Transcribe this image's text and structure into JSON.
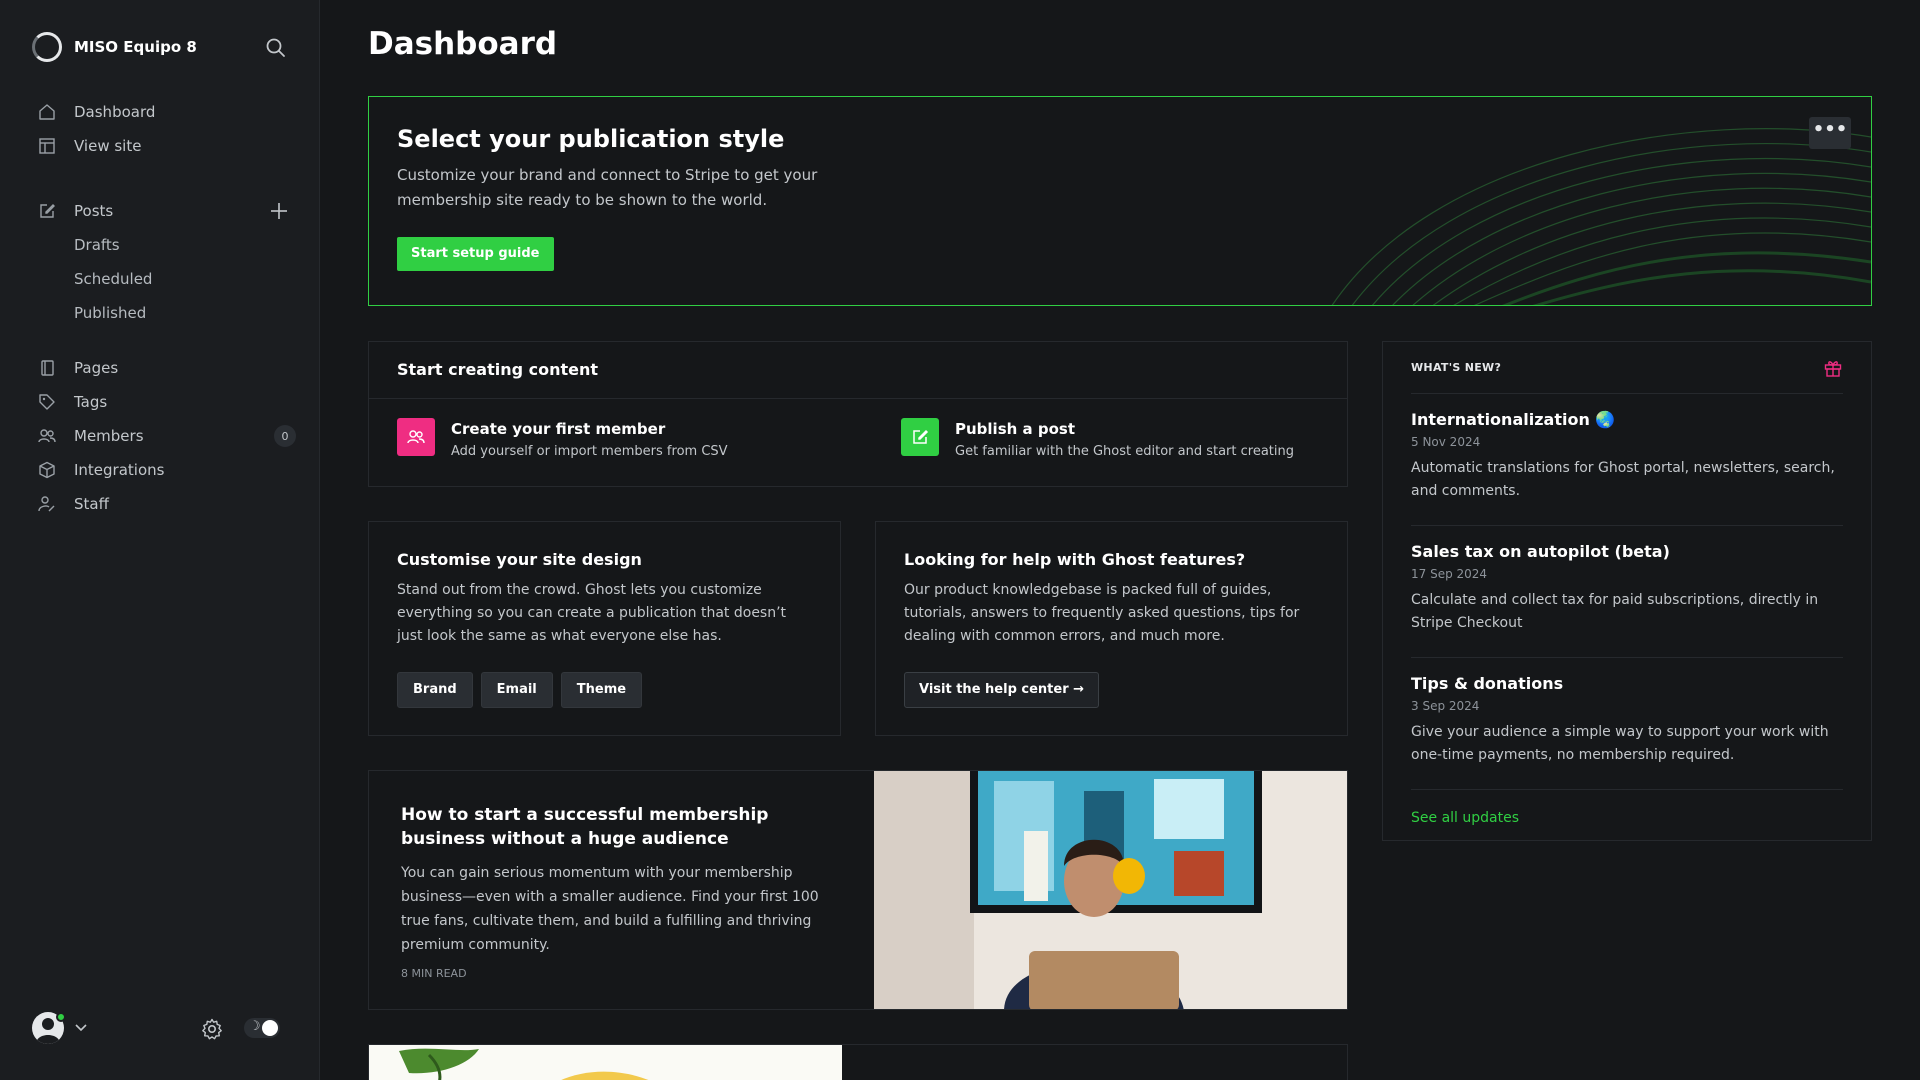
{
  "sidebar": {
    "site_name": "MISO Equipo 8",
    "nav": {
      "dashboard": "Dashboard",
      "view_site": "View site",
      "posts": "Posts",
      "drafts": "Drafts",
      "scheduled": "Scheduled",
      "published": "Published",
      "pages": "Pages",
      "tags": "Tags",
      "members": "Members",
      "members_count": "0",
      "integrations": "Integrations",
      "staff": "Staff"
    },
    "theme_toggle_glyph": "☽"
  },
  "page": {
    "title": "Dashboard"
  },
  "banner": {
    "title": "Select your publication style",
    "description": "Customize your brand and connect to Stripe to get your membership site ready to be shown to the world.",
    "cta": "Start setup guide",
    "menu": "•••"
  },
  "start_creating": {
    "title": "Start creating content",
    "items": [
      {
        "title": "Create your first member",
        "desc": "Add yourself or import members from CSV",
        "icon": "members-icon",
        "color": "#ef2d82"
      },
      {
        "title": "Publish a post",
        "desc": "Get familiar with the Ghost editor and start creating",
        "icon": "edit-icon",
        "color": "#30cf43"
      }
    ]
  },
  "design": {
    "title": "Customise your site design",
    "text": "Stand out from the crowd. Ghost lets you customize everything so you can create a publication that doesn’t just look the same as what everyone else has.",
    "buttons": [
      "Brand",
      "Email",
      "Theme"
    ]
  },
  "help": {
    "title": "Looking for help with Ghost features?",
    "text": "Our product knowledgebase is packed full of guides, tutorials, answers to frequently asked questions, tips for dealing with common errors, and much more.",
    "button": "Visit the help center →"
  },
  "article": {
    "title": "How to start a successful membership business without a huge audience",
    "excerpt": "You can gain serious momentum with your membership business—even with a smaller audience. Find your first 100 true fans, cultivate them, and build a fulfilling and thriving premium community.",
    "meta": "8 MIN READ"
  },
  "whats_new": {
    "label": "WHAT'S NEW?",
    "items": [
      {
        "title": "Internationalization 🌏",
        "date": "5 Nov 2024",
        "desc": "Automatic translations for Ghost portal, newsletters, search, and comments."
      },
      {
        "title": "Sales tax on autopilot (beta)",
        "date": "17 Sep 2024",
        "desc": "Calculate and collect tax for paid subscriptions, directly in Stripe Checkout"
      },
      {
        "title": "Tips & donations",
        "date": "3 Sep 2024",
        "desc": "Give your audience a simple way to support your work with one-time payments, no membership required."
      }
    ],
    "link": "See all updates"
  },
  "colors": {
    "accent": "#30cf43",
    "pink": "#ef2d82",
    "background": "#151719",
    "sidebar": "#1b1d20"
  }
}
